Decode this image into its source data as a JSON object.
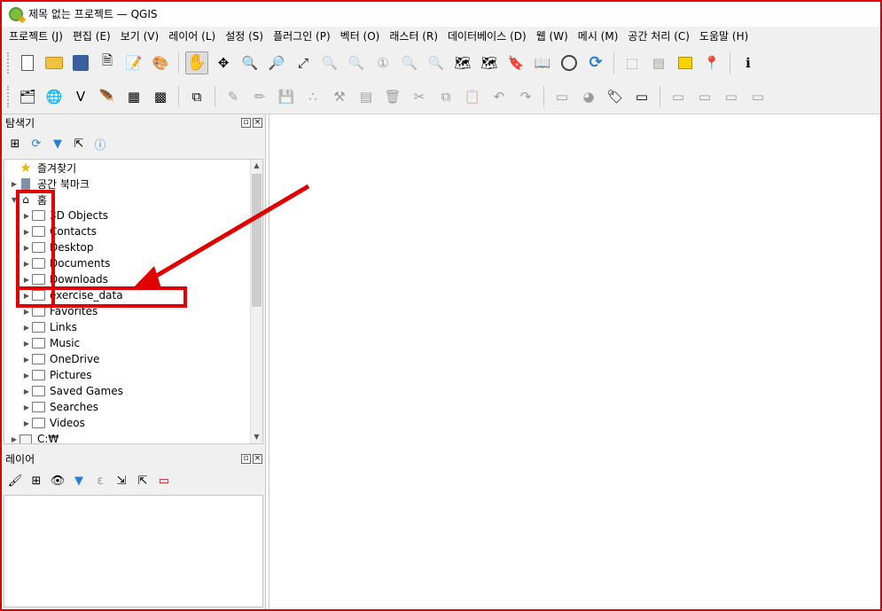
{
  "window": {
    "title": "제목 없는 프로젝트 — QGIS"
  },
  "menu": [
    "프로젝트 (J)",
    "편집 (E)",
    "보기 (V)",
    "레이어 (L)",
    "설정 (S)",
    "플러그인 (P)",
    "벡터 (O)",
    "래스터 (R)",
    "데이터베이스 (D)",
    "웹 (W)",
    "메시 (M)",
    "공간 처리 (C)",
    "도움말 (H)"
  ],
  "browser": {
    "title": "탐색기",
    "items": {
      "favorites": "즐겨찾기",
      "spatial_bookmarks": "공간 북마크",
      "home": "홈",
      "objects3d": "3D Objects",
      "contacts": "Contacts",
      "desktop": "Desktop",
      "documents": "Documents",
      "downloads": "Downloads",
      "exercise_data": "exercise_data",
      "favorites_folder": "Favorites",
      "links": "Links",
      "music": "Music",
      "onedrive": "OneDrive",
      "pictures": "Pictures",
      "saved_games": "Saved Games",
      "searches": "Searches",
      "videos": "Videos",
      "c_drive": "C:₩"
    }
  },
  "layers": {
    "title": "레이어"
  },
  "annotation": {
    "color": "#e00000"
  }
}
